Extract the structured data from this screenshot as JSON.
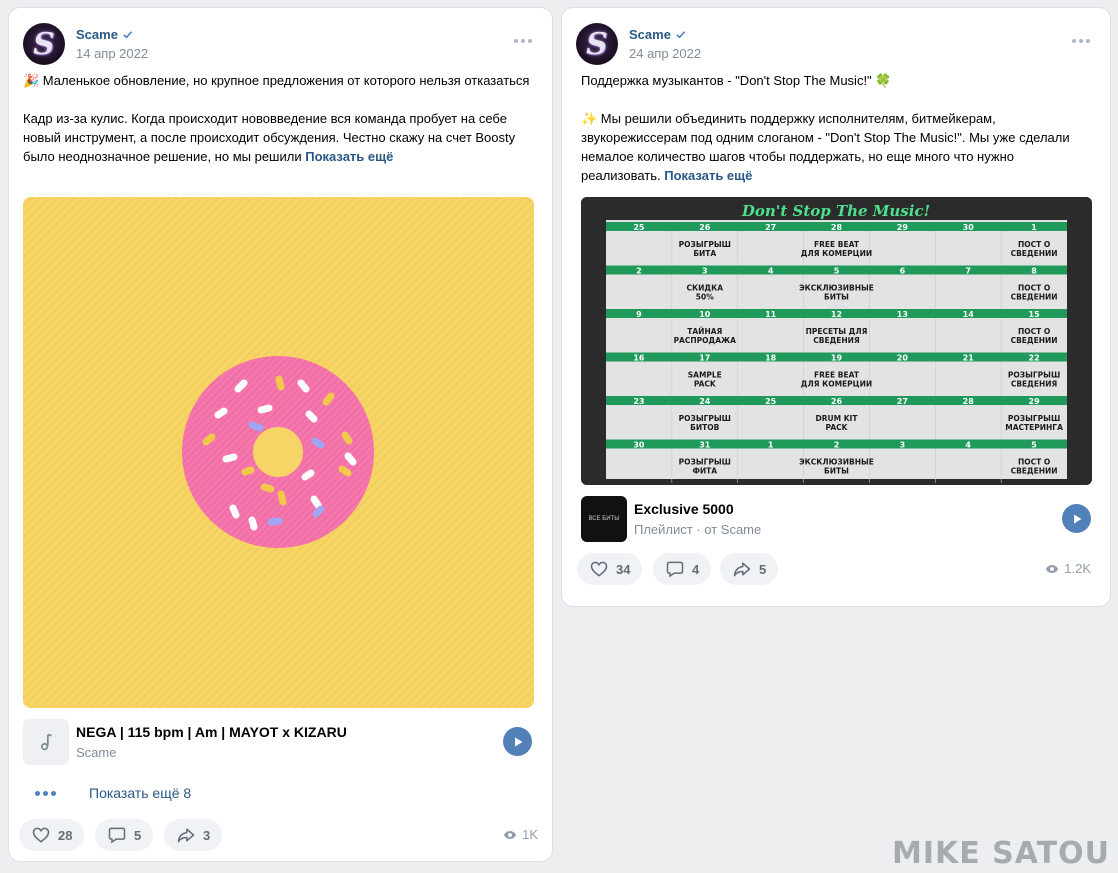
{
  "posts": [
    {
      "author": "Scame",
      "date": "14 апр 2022",
      "text": {
        "line1": "🎉 Маленькое обновление, но крупное предложения от которого нельзя отказаться",
        "line2": "Кадр из-за кулис. Когда происходит нововведение вся команда пробует на себе новый инструмент, а после происходит обсуждения. Честно скажу на счет Boosty было неоднозначное решение, но мы решили",
        "show_more": "Показать ещё"
      },
      "image_desc": "donut",
      "audio": {
        "title": "NEGA | 115 bpm | Am | MAYOT x KIZARU",
        "artist": "Scame"
      },
      "show_more_count": "Показать ещё 8",
      "likes": "28",
      "comments": "5",
      "shares": "3",
      "views": "1K"
    },
    {
      "author": "Scame",
      "date": "24 апр 2022",
      "text": {
        "line1": "Поддержка музыкантов - \"Don't Stop The Music!\" 🍀",
        "line2": "✨ Мы решили объединить поддержку исполнителям, битмейкерам, звукорежиссерам под одним слоганом - \"Don't Stop The Music!\". Мы уже сделали немалое количество шагов чтобы поддержать, но еще много что нужно реализовать.",
        "show_more": "Показать ещё"
      },
      "calendar": {
        "title": "Don't Stop The Music!",
        "rows": [
          {
            "nums": [
              "25",
              "26",
              "27",
              "28",
              "29",
              "30",
              "1"
            ],
            "cells": [
              "",
              "РОЗЫГРЫШ БИТА",
              "",
              "FREE BEAT ДЛЯ КОМЕРЦИИ",
              "",
              "",
              "ПОСТ О СВЕДЕНИИ"
            ]
          },
          {
            "nums": [
              "2",
              "3",
              "4",
              "5",
              "6",
              "7",
              "8"
            ],
            "cells": [
              "",
              "СКИДКА 50%",
              "",
              "ЭКСКЛЮЗИВНЫЕ БИТЫ",
              "",
              "",
              "ПОСТ О СВЕДЕНИИ"
            ]
          },
          {
            "nums": [
              "9",
              "10",
              "11",
              "12",
              "13",
              "14",
              "15"
            ],
            "cells": [
              "",
              "ТАЙНАЯ РАСПРОДАЖА",
              "",
              "ПРЕСЕТЫ ДЛЯ СВЕДЕНИЯ",
              "",
              "",
              "ПОСТ О СВЕДЕНИИ"
            ]
          },
          {
            "nums": [
              "16",
              "17",
              "18",
              "19",
              "20",
              "21",
              "22"
            ],
            "cells": [
              "",
              "SAMPLE PACK",
              "",
              "FREE BEAT ДЛЯ КОМЕРЦИИ",
              "",
              "",
              "РОЗЫГРЫШ СВЕДЕНИЯ"
            ]
          },
          {
            "nums": [
              "23",
              "24",
              "25",
              "26",
              "27",
              "28",
              "29"
            ],
            "cells": [
              "",
              "РОЗЫГРЫШ БИТОВ",
              "",
              "DRUM KIT PACK",
              "",
              "",
              "РОЗЫГРЫШ МАСТЕРИНГА"
            ]
          },
          {
            "nums": [
              "30",
              "31",
              "1",
              "2",
              "3",
              "4",
              "5"
            ],
            "cells": [
              "",
              "РОЗЫГРЫШ ФИТА",
              "",
              "ЭКСКЛЮЗИВНЫЕ БИТЫ",
              "",
              "",
              "ПОСТ О СВЕДЕНИИ"
            ]
          }
        ]
      },
      "audio": {
        "title": "Exclusive 5000",
        "artist": "Плейлист · от Scame",
        "cover_text": "ВСЕ БИТЫ"
      },
      "likes": "34",
      "comments": "4",
      "shares": "5",
      "views": "1.2K"
    }
  ],
  "watermark": "MIKE SATOU"
}
